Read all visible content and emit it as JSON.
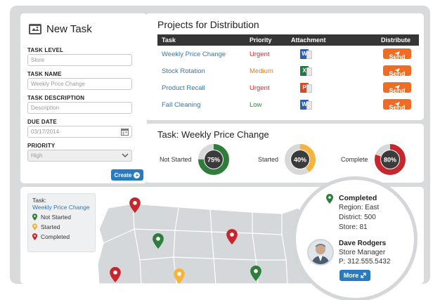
{
  "new_task": {
    "title": "New Task",
    "fields": [
      {
        "label": "TASK LEVEL",
        "placeholder": "Store"
      },
      {
        "label": "TASK NAME",
        "placeholder": "Weekly Price Change"
      },
      {
        "label": "TASK DESCRIPTION",
        "placeholder": "Description"
      },
      {
        "label": "DUE DATE",
        "value": "03/17/2014"
      },
      {
        "label": "PRIORITY",
        "value": "High"
      }
    ],
    "create_label": "Create"
  },
  "projects": {
    "title": "Projects for Distribution",
    "headers": [
      "Task",
      "Priority",
      "Attachment",
      "Distribute"
    ],
    "rows": [
      {
        "task": "Weekly Price Change",
        "priority": "Urgent",
        "attachment_icon": "word-icon",
        "attachment_glyph": "W",
        "attachment_color": "#2b5fb4",
        "send": "Send"
      },
      {
        "task": "Stock Rotation",
        "priority": "Medium",
        "attachment_icon": "excel-icon",
        "attachment_glyph": "X",
        "attachment_color": "#1f7a40",
        "send": "Send"
      },
      {
        "task": "Product Recall",
        "priority": "Urgent",
        "attachment_icon": "powerpoint-icon",
        "attachment_glyph": "P",
        "attachment_color": "#d34a24",
        "send": "Send"
      },
      {
        "task": "Fall Cleaning",
        "priority": "Low",
        "attachment_icon": "word-icon",
        "attachment_glyph": "W",
        "attachment_color": "#2b5fb4",
        "send": "Send"
      }
    ]
  },
  "status": {
    "title": "Task: Weekly Price Change",
    "items": [
      {
        "label": "Not Started",
        "percent": 75,
        "percent_label": "75%",
        "color": "#2e7d3b"
      },
      {
        "label": "Started",
        "percent": 40,
        "percent_label": "40%",
        "color": "#f4b53f"
      },
      {
        "label": "Complete",
        "percent": 80,
        "percent_label": "80%",
        "color": "#c7262c"
      }
    ]
  },
  "map": {
    "legend_title": "Task:",
    "legend_link": "Weekly Price Change",
    "legend_items": [
      {
        "label": "Not Started",
        "color": "#2e7d3b"
      },
      {
        "label": "Started",
        "color": "#f4b53f"
      },
      {
        "label": "Completed",
        "color": "#c7262c"
      }
    ]
  },
  "callout": {
    "status": "Completed",
    "region": "Region: East",
    "district": "District: 500",
    "store": "Store: 81",
    "name": "Dave Rodgers",
    "role": "Store Manager",
    "phone": "P: 312.555.5432",
    "more_label": "More"
  },
  "colors": {
    "accent_blue": "#2a7abf",
    "send_orange": "#ef6c24",
    "header_dark": "#353535",
    "green": "#2e7d3b",
    "yellow": "#f4b53f",
    "red": "#c7262c"
  }
}
